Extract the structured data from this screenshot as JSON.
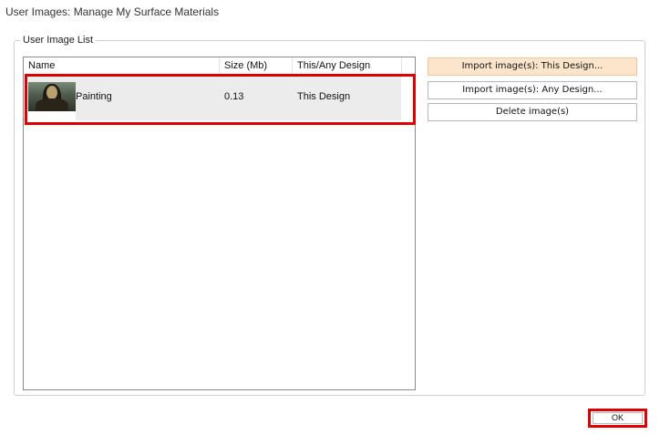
{
  "window": {
    "title": "User Images: Manage My Surface Materials"
  },
  "group": {
    "label": "User Image List"
  },
  "list": {
    "columns": [
      "Name",
      "Size (Mb)",
      "This/Any Design"
    ],
    "rows": [
      {
        "name": "Painting",
        "size": "0.13",
        "design": "This Design",
        "thumbnail": "painting-thumbnail"
      }
    ]
  },
  "buttons": {
    "import_this": "Import image(s): This Design...",
    "import_any": "Import image(s): Any Design...",
    "delete": "Delete image(s)",
    "ok": "OK"
  },
  "colors": {
    "primary_button_bg": "#fde5cc",
    "highlight_outline": "#dd0000",
    "selected_row_bg": "#ececec"
  }
}
